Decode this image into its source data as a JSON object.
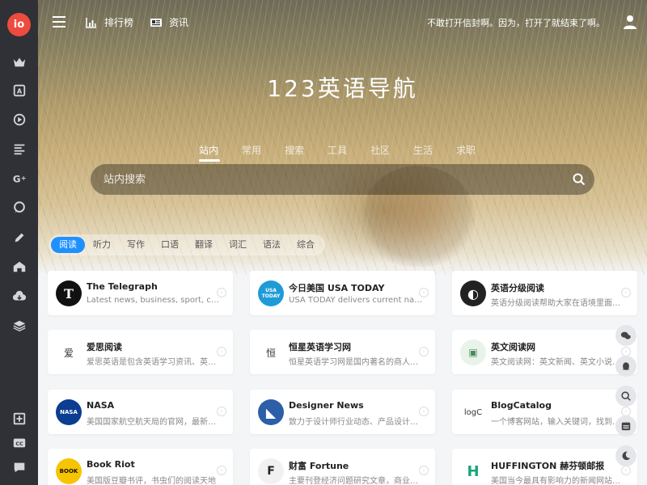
{
  "sidebar": {
    "logo": "io",
    "icons": [
      "crown-icon",
      "dictionary-icon",
      "play-circle-icon",
      "list-icon",
      "google-plus-icon",
      "chat-bubble-icon",
      "pencil-icon",
      "school-icon",
      "cloud-download-icon",
      "layers-icon",
      "plus-square-icon",
      "cc-icon",
      "message-icon"
    ]
  },
  "header": {
    "nav": [
      {
        "label": "排行榜",
        "icon": "bar-chart-icon"
      },
      {
        "label": "资讯",
        "icon": "newspaper-icon"
      }
    ],
    "motto": "不敢打开信封啊。因为，打开了就结束了啊。"
  },
  "hero": {
    "title": "123英语导航",
    "search_tabs": [
      "站内",
      "常用",
      "搜索",
      "工具",
      "社区",
      "生活",
      "求职"
    ],
    "active_search_tab": 0,
    "search_placeholder": "站内搜索"
  },
  "categories": {
    "tabs": [
      "阅读",
      "听力",
      "写作",
      "口语",
      "翻译",
      "词汇",
      "语法",
      "综合"
    ],
    "active": 0
  },
  "cards": [
    {
      "title": "The Telegraph",
      "desc": "Latest news, business, sport, comment, lifestyle and culture",
      "icon": "telegraph-logo",
      "color": "#111111",
      "glyph": "T"
    },
    {
      "title": "今日美国 USA TODAY",
      "desc": "USA TODAY delivers current national and local news",
      "icon": "usatoday-logo",
      "color": "#1e9bd7",
      "glyph": "USA TODAY"
    },
    {
      "title": "英语分级阅读",
      "desc": "英语分级阅读帮助大家在语境里面记忆单词",
      "icon": "globe-logo",
      "color": "#222222",
      "glyph": "◐"
    },
    {
      "title": "爱思阅读",
      "desc": "爱思英语是包含英语学习资讯、英语考试资料",
      "icon": "aisi-logo",
      "color": "#ffffff",
      "glyph": "爱"
    },
    {
      "title": "恒星英语学习网",
      "desc": "恒星英语学习网是国内著名的商人气英语学习网站",
      "icon": "hengxing-logo",
      "color": "#ffffff",
      "glyph": "恒"
    },
    {
      "title": "英文阅读网",
      "desc": "英文阅读网：英文新闻、英文小说、英文杂志",
      "icon": "reading-logo",
      "color": "#e8f3ea",
      "glyph": "▣"
    },
    {
      "title": "NASA",
      "desc": "美国国家航空航天局的官网，最新太空资讯",
      "icon": "nasa-logo",
      "color": "#0b3d91",
      "glyph": "NASA"
    },
    {
      "title": "Designer News",
      "desc": "致力于设计师行业动态、产品设计资讯分享",
      "icon": "designer-news-logo",
      "color": "#2d5fa8",
      "glyph": "◣"
    },
    {
      "title": "BlogCatalog",
      "desc": "一个博客网站，输入关键词，找到你想要的博客",
      "icon": "blogcatalog-logo",
      "color": "#ffffff",
      "glyph": "logC"
    },
    {
      "title": "Book Riot",
      "desc": "美国版豆瓣书评，书虫们的阅读天地",
      "icon": "bookriot-logo",
      "color": "#f6c400",
      "glyph": "BOOK"
    },
    {
      "title": "财富 Fortune",
      "desc": "主要刊登经济问题研究文章，商业资讯",
      "icon": "fortune-logo",
      "color": "#f1f1f1",
      "glyph": "F"
    },
    {
      "title": "HUFFINGTON 赫芬顿邮报",
      "desc": "美国当今最具有影响力的新闻网站之一",
      "icon": "huffington-logo",
      "color": "#ffffff",
      "glyph": "H"
    }
  ],
  "floating": [
    "wechat-icon",
    "qq-icon",
    "search-icon",
    "calendar-icon",
    "moon-icon"
  ]
}
